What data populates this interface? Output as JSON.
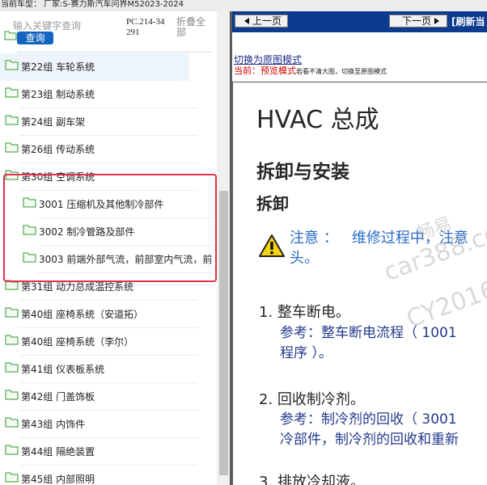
{
  "topbar": {
    "text": "当前车型：  厂家:S-赛力斯汽车问界M52023-2024"
  },
  "search": {
    "placeholder": "输入关键字查询",
    "button_label": "查询",
    "model_code": "PC.214-34291",
    "collapse_label": "折叠全部"
  },
  "tree": {
    "items": [
      {
        "label": "第22组 车轮系统",
        "level": 1
      },
      {
        "label": "第23组 制动系统",
        "level": 1
      },
      {
        "label": "第24组 副车架",
        "level": 1
      },
      {
        "label": "第26组 传动系统",
        "level": 1
      },
      {
        "label": "第30组 空调系统",
        "level": 1
      },
      {
        "label": "3001 压缩机及其他制冷部件",
        "level": 2
      },
      {
        "label": "3002 制冷管路及部件",
        "level": 2
      },
      {
        "label": "3003 前端外部气流，前部室内气流，前",
        "level": 2
      },
      {
        "label": "第31组 动力总成温控系统",
        "level": 1
      },
      {
        "label": "第40组 座椅系统（安道拓）",
        "level": 1
      },
      {
        "label": "第40组 座椅系统（李尔）",
        "level": 1
      },
      {
        "label": "第41组 仪表板系统",
        "level": 1
      },
      {
        "label": "第42组 门盖饰板",
        "level": 1
      },
      {
        "label": "第43组 内饰件",
        "level": 1
      },
      {
        "label": "第44组 隔绝装置",
        "level": 1
      },
      {
        "label": "第45组 内部照明",
        "level": 1
      }
    ]
  },
  "nav": {
    "prev_label": "上一页",
    "next_label": "下一页",
    "refresh_label": "[刷新当"
  },
  "mode": {
    "switch_link": "切换为原图模式",
    "current_label": "当前：",
    "current_mode": "预览模式",
    "hint": "若看不清大图，切换至原图模式"
  },
  "doc": {
    "title": "HVAC 总成",
    "subtitle": "拆卸与安装",
    "section": "拆卸",
    "warning_label": "注意 ：",
    "warning_text": "维修过程中，注意",
    "warning_text_2": "头。",
    "step1": "1. 整车断电。",
    "ref1_line1": "参考：整车断电流程（ 1001",
    "ref1_line2": "程序 ）。",
    "step2": "2. 回收制冷剂。",
    "ref2_line1": "参考：制冷剂的回收（ 3001",
    "ref2_line2": "冷部件，制冷剂的回收和重新",
    "step3": "3. 排放冷却液。"
  },
  "watermark": {
    "line1": "畅易",
    "line2": "car388.co",
    "line3": "CY2016"
  },
  "colors": {
    "nav_bar": "#0c3b8f",
    "search_button": "#1565c0",
    "highlight_border": "#e0304a",
    "folder_icon": "#2e9a2e",
    "reference_text": "#233a8c",
    "warning_text": "#2a6cc4",
    "mode_red": "#d40000"
  }
}
